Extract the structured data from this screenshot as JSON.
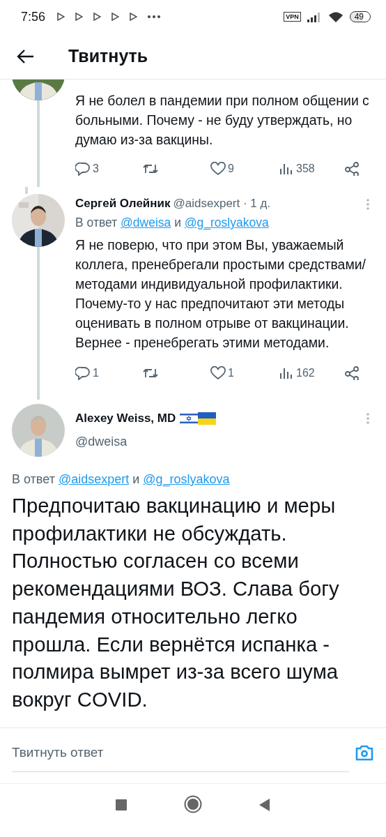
{
  "status_bar": {
    "time": "7:56",
    "vpn": "VPN",
    "battery": "49"
  },
  "header": {
    "title": "Твитнуть"
  },
  "tweets": [
    {
      "kind": "cut",
      "text": "Я не болел в пандемии при полном общении с больными. Почему - не буду утверждать, но думаю из-за вакцины.",
      "actions": {
        "replies": "3",
        "likes": "9",
        "views": "358"
      }
    },
    {
      "kind": "full",
      "name": "Сергей Олейник",
      "meta": "@aidsexpert · 1 д.",
      "reply_prefix": "В ответ",
      "reply_to": [
        "@dweisa",
        "@g_roslyakova"
      ],
      "reply_joiner": "и",
      "text": "Я не поверю, что при этом Вы, уважаемый коллега, пренебрегали простыми средствами/методами индивидуальной профилактики. Почему-то у нас предпочитают эти методы оценивать в полном отрыве от вакцинации. Вернее - пренебрегать этими методами.",
      "actions": {
        "replies": "1",
        "likes": "1",
        "views": "162"
      }
    }
  ],
  "focused": {
    "name": "Alexey Weiss, MD",
    "handle": "@dweisa",
    "reply_prefix": "В ответ",
    "reply_to": [
      "@aidsexpert",
      "@g_roslyakova"
    ],
    "reply_joiner": "и",
    "text": "Предпочитаю вакцинацию и меры профилактики не обсуждать. Полностью согласен со всеми рекомендациями ВОЗ. Слава богу пандемия относительно легко прошла. Если вернётся испанка - полмира вымрет из-за всего шума вокруг COVID."
  },
  "reply_box": {
    "placeholder": "Твитнуть ответ"
  }
}
